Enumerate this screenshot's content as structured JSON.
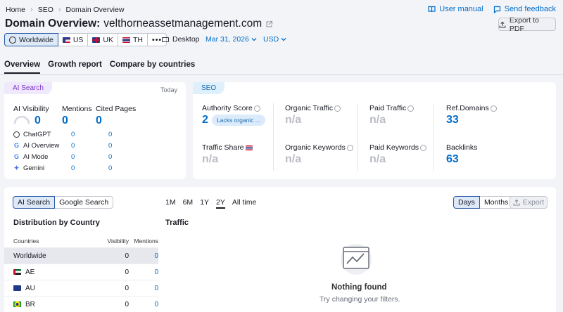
{
  "breadcrumb": [
    "Home",
    "SEO",
    "Domain Overview"
  ],
  "toplinks": {
    "manual": "User manual",
    "feedback": "Send feedback"
  },
  "title": {
    "prefix": "Domain Overview:",
    "domain": "velthorneassetmanagement.com"
  },
  "export_pdf": "Export to PDF",
  "databases": [
    "Worldwide",
    "US",
    "UK",
    "TH"
  ],
  "more": "•••",
  "device": "Desktop",
  "date": "Mar 31, 2026",
  "currency": "USD",
  "tabs": [
    "Overview",
    "Growth report",
    "Compare by countries"
  ],
  "ai_card": {
    "badge": "AI Search",
    "period": "Today",
    "metrics": [
      {
        "label": "AI Visibility",
        "value": "0"
      },
      {
        "label": "Mentions",
        "value": "0"
      },
      {
        "label": "Cited Pages",
        "value": "0"
      }
    ],
    "engines": [
      {
        "name": "ChatGPT",
        "mentions": "0",
        "cited": "0"
      },
      {
        "name": "AI Overview",
        "mentions": "0",
        "cited": "0"
      },
      {
        "name": "AI Mode",
        "mentions": "0",
        "cited": "0"
      },
      {
        "name": "Gemini",
        "mentions": "0",
        "cited": "0"
      }
    ]
  },
  "seo_card": {
    "badge": "SEO",
    "authority": {
      "label": "Authority Score",
      "value": "2",
      "pill": "Lacks organic ..."
    },
    "organic_traffic": {
      "label": "Organic Traffic",
      "value": "n/a"
    },
    "paid_traffic": {
      "label": "Paid Traffic",
      "value": "n/a"
    },
    "ref_domains": {
      "label": "Ref.Domains",
      "value": "33"
    },
    "traffic_share": {
      "label": "Traffic Share",
      "value": "n/a"
    },
    "organic_keywords": {
      "label": "Organic Keywords",
      "value": "n/a"
    },
    "paid_keywords": {
      "label": "Paid Keywords",
      "value": "n/a"
    },
    "backlinks": {
      "label": "Backlinks",
      "value": "63"
    }
  },
  "bottom": {
    "search_toggle": [
      "AI Search",
      "Google Search"
    ],
    "periods": [
      "1M",
      "6M",
      "1Y",
      "2Y",
      "All time"
    ],
    "granularity": [
      "Days",
      "Months"
    ],
    "export": "Export",
    "dist_title": "Distribution by Country",
    "traffic_title": "Traffic",
    "columns": [
      "Countries",
      "Visibility",
      "Mentions"
    ],
    "rows": [
      {
        "country": "Worldwide",
        "visibility": "0",
        "mentions": "0"
      },
      {
        "country": "AE",
        "visibility": "0",
        "mentions": "0"
      },
      {
        "country": "AU",
        "visibility": "0",
        "mentions": "0"
      },
      {
        "country": "BR",
        "visibility": "0",
        "mentions": "0"
      }
    ],
    "empty_title": "Nothing found",
    "empty_sub": "Try changing your filters."
  }
}
